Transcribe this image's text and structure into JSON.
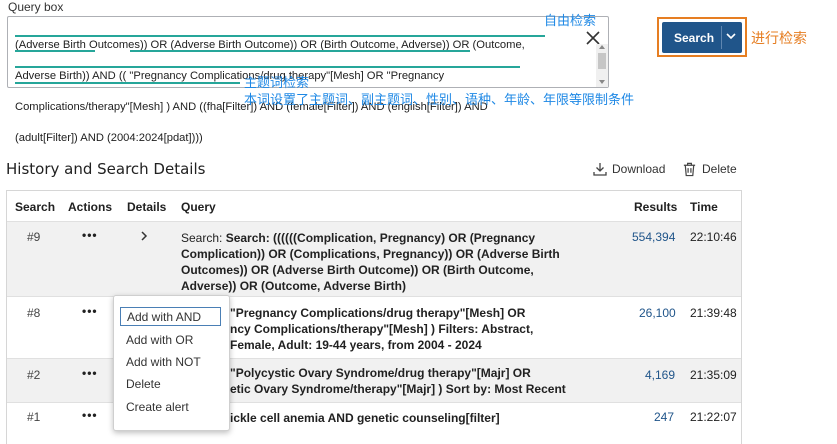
{
  "query_box": {
    "label": "Query box",
    "lines": [
      "(Adverse Birth Outcomes)) OR (Adverse Birth Outcome)) OR (Birth Outcome, Adverse)) OR (Outcome,",
      "Adverse Birth)) AND (( \"Pregnancy Complications/drug therapy\"[Mesh] OR \"Pregnancy",
      "Complications/therapy\"[Mesh] ) AND ((fha[Filter]) AND (female[Filter]) AND (english[Filter]) AND",
      "(adult[Filter]) AND (2004:2024[pdat])))"
    ]
  },
  "annotations": {
    "free_search": "自由检索",
    "mesh_search": "主题词检索",
    "mesh_note": "本词设置了主题词、副主题词、性别、语种、年龄、年限等限制条件",
    "do_search": "进行检索"
  },
  "search_button": {
    "label": "Search"
  },
  "history": {
    "title": "History and Search Details",
    "download_label": "Download",
    "delete_label": "Delete",
    "columns": {
      "search": "Search",
      "actions": "Actions",
      "details": "Details",
      "query": "Query",
      "results": "Results",
      "time": "Time"
    },
    "rows": [
      {
        "num": "#9",
        "actions": "•••",
        "details": ">",
        "query_lines": [
          "Search: ((((((Complication, Pregnancy) OR (Pregnancy",
          "Complication)) OR (Complications, Pregnancy)) OR (Adverse Birth",
          "Outcomes)) OR (Adverse Birth Outcome)) OR (Birth Outcome,",
          "Adverse)) OR (Outcome, Adverse Birth)"
        ],
        "results": "554,394",
        "time": "22:10:46"
      },
      {
        "num": "#8",
        "actions": "•••",
        "query_lines": [
          "\"Pregnancy Complications/drug therapy\"[Mesh] OR",
          "ncy Complications/therapy\"[Mesh] ) Filters: Abstract,",
          "Female, Adult: 19-44 years, from 2004 - 2024"
        ],
        "results": "26,100",
        "time": "21:39:48"
      },
      {
        "num": "#2",
        "actions": "•••",
        "query_lines": [
          "\"Polycystic Ovary Syndrome/drug therapy\"[Majr] OR",
          "etic Ovary Syndrome/therapy\"[Majr] ) Sort by: Most Recent"
        ],
        "results": "4,169",
        "time": "21:35:09"
      },
      {
        "num": "#1",
        "actions": "•••",
        "query_lines": [
          "ickle cell anemia AND genetic counseling[filter]"
        ],
        "results": "247",
        "time": "21:22:07"
      }
    ]
  },
  "actions_menu": {
    "items": [
      "Add with AND",
      "Add with OR",
      "Add with NOT",
      "Delete",
      "Create alert"
    ]
  },
  "colors": {
    "search_button": "#20558a",
    "annotation_blue": "#1e88e5",
    "annotation_orange": "#e67e22",
    "underline": "#26a69a",
    "result_link": "#20558a"
  }
}
